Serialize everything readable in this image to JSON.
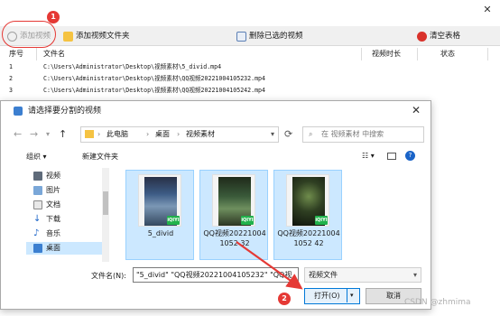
{
  "toolbar": {
    "add_video": "添加视频",
    "add_folder": "添加视频文件夹",
    "delete_selected": "删除已选的视频",
    "clear_table": "清空表格"
  },
  "table": {
    "headers": [
      "序号",
      "文件名",
      "视频时长",
      "状态"
    ],
    "rows": [
      {
        "index": "1",
        "file": "C:\\Users\\Administrator\\Desktop\\视频素材\\5_divid.mp4"
      },
      {
        "index": "2",
        "file": "C:\\Users\\Administrator\\Desktop\\视频素材\\QQ视频20221004105232.mp4"
      },
      {
        "index": "3",
        "file": "C:\\Users\\Administrator\\Desktop\\视频素材\\QQ视频20221004105242.mp4"
      }
    ]
  },
  "annotations": {
    "step1": "1",
    "step2": "2"
  },
  "dialog": {
    "title": "请选择要分割的视频",
    "breadcrumb": [
      "此电脑",
      "桌面",
      "视频素材"
    ],
    "search_placeholder": "在 视频素材 中搜索",
    "organize": "组织 ▾",
    "new_folder": "新建文件夹",
    "nav_tree": [
      {
        "label": "视频",
        "icon": "video-folder-icon"
      },
      {
        "label": "图片",
        "icon": "pictures-folder-icon"
      },
      {
        "label": "文档",
        "icon": "documents-folder-icon"
      },
      {
        "label": "下载",
        "icon": "download-folder-icon"
      },
      {
        "label": "音乐",
        "icon": "music-folder-icon"
      },
      {
        "label": "桌面",
        "icon": "desktop-folder-icon",
        "selected": true
      }
    ],
    "files": [
      {
        "name": "5_divid"
      },
      {
        "name": "QQ视频202210041052 32"
      },
      {
        "name": "QQ视频202210041052 42"
      }
    ],
    "filename_label": "文件名(N):",
    "filename_value": "\"5_divid\" \"QQ视频20221004105232\" \"QQ视",
    "filetype_value": "视频文件",
    "open_button": "打开(O)",
    "cancel_button": "取消"
  },
  "watermark": "CSDN @zhmima",
  "colors": {
    "accent": "#0078d7",
    "annotation_red": "#e53935",
    "selection": "#cce8ff"
  }
}
